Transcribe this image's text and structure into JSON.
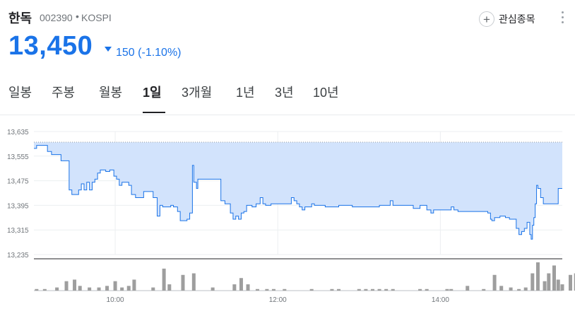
{
  "header": {
    "name": "한독",
    "code": "002390",
    "separator": "•",
    "exchange": "KOSPI",
    "follow_label": "관심종목",
    "follow_icon": "plus-icon",
    "more_icon": "more-vert-icon"
  },
  "quote": {
    "price": "13,450",
    "direction": "down",
    "change": "150",
    "change_pct": "(-1.10%)",
    "color": "#1a73e8"
  },
  "tabs": [
    {
      "label": "일봉",
      "active": false
    },
    {
      "label": "주봉",
      "active": false
    },
    {
      "label": "월봉",
      "active": false
    },
    {
      "label": "1일",
      "active": true
    },
    {
      "label": "3개월",
      "active": false
    },
    {
      "label": "1년",
      "active": false
    },
    {
      "label": "3년",
      "active": false
    },
    {
      "label": "10년",
      "active": false
    }
  ],
  "chart_data": {
    "type": "area",
    "x_ticks": [
      "10:00",
      "12:00",
      "14:00"
    ],
    "y_ticks": [
      "13,635",
      "13,555",
      "13,475",
      "13,395",
      "13,315",
      "13,235"
    ],
    "ylim": [
      13235,
      13635
    ],
    "xlim": [
      "09:00",
      "15:30"
    ],
    "reference_line": 13600,
    "line_color": "#1a73e8",
    "fill_color": "#d2e3fc",
    "price": [
      [
        "09:00",
        13580
      ],
      [
        "09:02",
        13590
      ],
      [
        "09:07",
        13590
      ],
      [
        "09:10",
        13570
      ],
      [
        "09:13",
        13560
      ],
      [
        "09:17",
        13560
      ],
      [
        "09:20",
        13540
      ],
      [
        "09:24",
        13540
      ],
      [
        "09:26",
        13445
      ],
      [
        "09:28",
        13430
      ],
      [
        "09:31",
        13430
      ],
      [
        "09:33",
        13445
      ],
      [
        "09:35",
        13465
      ],
      [
        "09:37",
        13445
      ],
      [
        "09:39",
        13470
      ],
      [
        "09:41",
        13445
      ],
      [
        "09:43",
        13470
      ],
      [
        "09:45",
        13480
      ],
      [
        "09:47",
        13500
      ],
      [
        "09:49",
        13510
      ],
      [
        "09:51",
        13510
      ],
      [
        "09:53",
        13505
      ],
      [
        "09:56",
        13510
      ],
      [
        "09:59",
        13490
      ],
      [
        "10:01",
        13480
      ],
      [
        "10:03",
        13460
      ],
      [
        "10:05",
        13470
      ],
      [
        "10:08",
        13470
      ],
      [
        "10:10",
        13460
      ],
      [
        "10:12",
        13430
      ],
      [
        "10:15",
        13420
      ],
      [
        "10:18",
        13420
      ],
      [
        "10:21",
        13440
      ],
      [
        "10:25",
        13440
      ],
      [
        "10:28",
        13420
      ],
      [
        "10:30",
        13420
      ],
      [
        "10:31",
        13360
      ],
      [
        "10:33",
        13395
      ],
      [
        "10:35",
        13390
      ],
      [
        "10:38",
        13390
      ],
      [
        "10:41",
        13395
      ],
      [
        "10:43",
        13390
      ],
      [
        "10:46",
        13375
      ],
      [
        "10:48",
        13345
      ],
      [
        "10:50",
        13345
      ],
      [
        "10:53",
        13350
      ],
      [
        "10:55",
        13370
      ],
      [
        "10:57",
        13525
      ],
      [
        "10:58",
        13470
      ],
      [
        "11:00",
        13450
      ],
      [
        "11:01",
        13480
      ],
      [
        "11:05",
        13480
      ],
      [
        "11:10",
        13480
      ],
      [
        "11:16",
        13480
      ],
      [
        "11:18",
        13410
      ],
      [
        "11:21",
        13400
      ],
      [
        "11:25",
        13370
      ],
      [
        "11:27",
        13350
      ],
      [
        "11:29",
        13360
      ],
      [
        "11:31",
        13350
      ],
      [
        "11:33",
        13370
      ],
      [
        "11:35",
        13375
      ],
      [
        "11:37",
        13395
      ],
      [
        "11:39",
        13395
      ],
      [
        "11:41",
        13390
      ],
      [
        "11:44",
        13400
      ],
      [
        "11:47",
        13420
      ],
      [
        "11:49",
        13400
      ],
      [
        "11:51",
        13395
      ],
      [
        "11:55",
        13400
      ],
      [
        "12:00",
        13400
      ],
      [
        "12:08",
        13400
      ],
      [
        "12:10",
        13420
      ],
      [
        "12:12",
        13410
      ],
      [
        "12:14",
        13400
      ],
      [
        "12:16",
        13390
      ],
      [
        "12:18",
        13380
      ],
      [
        "12:20",
        13390
      ],
      [
        "12:22",
        13390
      ],
      [
        "12:25",
        13400
      ],
      [
        "12:27",
        13395
      ],
      [
        "12:30",
        13395
      ],
      [
        "12:35",
        13390
      ],
      [
        "12:45",
        13395
      ],
      [
        "12:55",
        13390
      ],
      [
        "13:05",
        13390
      ],
      [
        "13:15",
        13395
      ],
      [
        "13:20",
        13395
      ],
      [
        "13:23",
        13410
      ],
      [
        "13:25",
        13395
      ],
      [
        "13:30",
        13395
      ],
      [
        "13:35",
        13395
      ],
      [
        "13:40",
        13385
      ],
      [
        "13:45",
        13395
      ],
      [
        "13:50",
        13380
      ],
      [
        "13:53",
        13370
      ],
      [
        "13:55",
        13380
      ],
      [
        "14:00",
        13380
      ],
      [
        "14:05",
        13380
      ],
      [
        "14:08",
        13390
      ],
      [
        "14:10",
        13380
      ],
      [
        "14:13",
        13375
      ],
      [
        "14:20",
        13375
      ],
      [
        "14:30",
        13375
      ],
      [
        "14:35",
        13370
      ],
      [
        "14:37",
        13350
      ],
      [
        "14:38",
        13345
      ],
      [
        "14:40",
        13355
      ],
      [
        "14:44",
        13360
      ],
      [
        "14:48",
        13355
      ],
      [
        "14:51",
        13350
      ],
      [
        "14:54",
        13350
      ],
      [
        "14:56",
        13320
      ],
      [
        "14:58",
        13300
      ],
      [
        "15:00",
        13310
      ],
      [
        "15:02",
        13320
      ],
      [
        "15:04",
        13340
      ],
      [
        "15:06",
        13300
      ],
      [
        "15:07",
        13285
      ],
      [
        "15:08",
        13330
      ],
      [
        "15:09",
        13355
      ],
      [
        "15:10",
        13400
      ],
      [
        "15:11",
        13460
      ],
      [
        "15:12",
        13450
      ],
      [
        "15:14",
        13420
      ],
      [
        "15:16",
        13400
      ],
      [
        "15:20",
        13400
      ],
      [
        "15:25",
        13400
      ],
      [
        "15:27",
        13450
      ],
      [
        "15:30",
        13450
      ]
    ],
    "volume": [
      [
        "09:02",
        1
      ],
      [
        "09:08",
        1
      ],
      [
        "09:17",
        2
      ],
      [
        "09:24",
        6
      ],
      [
        "09:30",
        7
      ],
      [
        "09:34",
        3
      ],
      [
        "09:41",
        2
      ],
      [
        "09:48",
        2
      ],
      [
        "09:54",
        3
      ],
      [
        "10:00",
        6
      ],
      [
        "10:05",
        2
      ],
      [
        "10:10",
        3
      ],
      [
        "10:14",
        7
      ],
      [
        "10:28",
        2
      ],
      [
        "10:36",
        14
      ],
      [
        "10:40",
        4
      ],
      [
        "10:50",
        10
      ],
      [
        "10:58",
        11
      ],
      [
        "11:12",
        2
      ],
      [
        "11:28",
        4
      ],
      [
        "11:33",
        8
      ],
      [
        "11:38",
        4
      ],
      [
        "11:45",
        1
      ],
      [
        "11:52",
        1
      ],
      [
        "11:57",
        1
      ],
      [
        "12:05",
        1
      ],
      [
        "12:25",
        1
      ],
      [
        "12:40",
        1
      ],
      [
        "12:45",
        1
      ],
      [
        "13:00",
        1
      ],
      [
        "13:05",
        1
      ],
      [
        "13:10",
        1
      ],
      [
        "13:15",
        1
      ],
      [
        "13:20",
        1
      ],
      [
        "13:25",
        1
      ],
      [
        "13:45",
        1
      ],
      [
        "13:50",
        1
      ],
      [
        "14:05",
        1
      ],
      [
        "14:08",
        1
      ],
      [
        "14:20",
        3
      ],
      [
        "14:32",
        1
      ],
      [
        "14:40",
        10
      ],
      [
        "14:45",
        3
      ],
      [
        "14:52",
        2
      ],
      [
        "14:58",
        1
      ],
      [
        "15:03",
        2
      ],
      [
        "15:08",
        11
      ],
      [
        "15:12",
        18
      ],
      [
        "15:17",
        6
      ],
      [
        "15:20",
        11
      ],
      [
        "15:24",
        16
      ],
      [
        "15:27",
        7
      ],
      [
        "15:30",
        4
      ],
      [
        "15:36",
        10
      ],
      [
        "15:40",
        11
      ]
    ],
    "grid": true,
    "legend": "none"
  }
}
